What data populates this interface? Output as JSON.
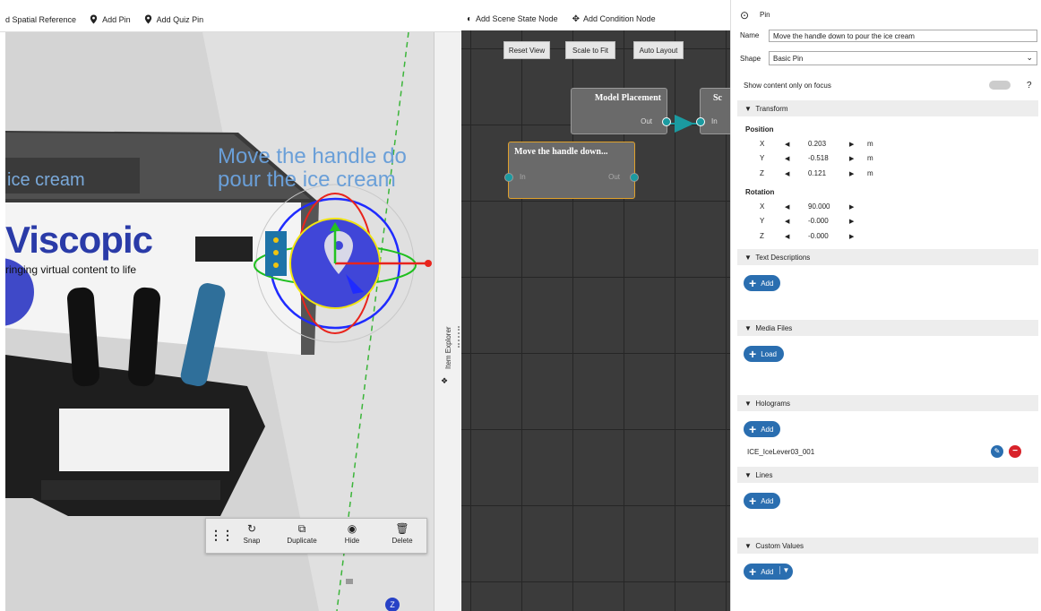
{
  "toolbar": {
    "spatial_reference": "d Spatial Reference",
    "add_pin": "Add Pin",
    "add_quiz_pin": "Add Quiz Pin"
  },
  "viewport": {
    "pin_title_line1": "Move the handle do",
    "pin_title_line2": "pour the ice cream",
    "machine_text_ice_cream": "ice cream",
    "logo_text": "Viscopic",
    "logo_tagline": "ringing virtual content to life",
    "axis_badge": "Z",
    "palette": {
      "snap": "Snap",
      "duplicate": "Duplicate",
      "hide": "Hide",
      "delete": "Delete"
    },
    "item_explorer": "Item Explorer"
  },
  "node_editor": {
    "add_scene_state_node": "Add Scene State Node",
    "add_condition_node": "Add Condition Node",
    "reset_view": "Reset View",
    "scale_to_fit": "Scale to Fit",
    "auto_layout": "Auto Layout",
    "node_model_placement": {
      "title": "Model Placement",
      "out": "Out"
    },
    "node_scene": {
      "title": "Sc",
      "in": "In"
    },
    "node_pin": {
      "title": "Move the handle down...",
      "in": "In",
      "out": "Out"
    }
  },
  "properties": {
    "header": "Pin",
    "name_label": "Name",
    "name_value": "Move the handle down to pour the ice cream",
    "shape_label": "Shape",
    "shape_value": "Basic Pin",
    "show_on_focus": "Show content only on focus",
    "help": "?",
    "transform": "Transform",
    "position_label": "Position",
    "position": [
      {
        "axis": "X",
        "value": "0.203",
        "unit": "m"
      },
      {
        "axis": "Y",
        "value": "-0.518",
        "unit": "m"
      },
      {
        "axis": "Z",
        "value": "0.121",
        "unit": "m"
      }
    ],
    "rotation_label": "Rotation",
    "rotation": [
      {
        "axis": "X",
        "value": "90.000"
      },
      {
        "axis": "Y",
        "value": "-0.000"
      },
      {
        "axis": "Z",
        "value": "-0.000"
      }
    ],
    "text_descriptions": "Text Descriptions",
    "add": "Add",
    "media_files": "Media Files",
    "load": "Load",
    "holograms": "Holograms",
    "hologram_item": "ICE_IceLever03_001",
    "lines": "Lines",
    "custom_values": "Custom Values"
  },
  "colors": {
    "accent_blue": "#2a6eb0",
    "node_connector": "#1b9aa0",
    "delete_red": "#d8232a",
    "grid_bg": "#3b3b3b"
  }
}
